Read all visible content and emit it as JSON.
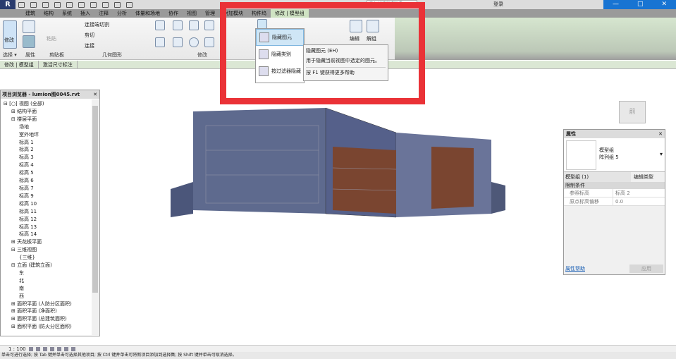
{
  "qat": {
    "logo": "R",
    "search_placeholder": "键入关键字或短语",
    "login": "登录"
  },
  "window": {
    "minimize": "—",
    "maximize": "□",
    "close": "✕"
  },
  "tabs": [
    "建筑",
    "结构",
    "系统",
    "插入",
    "注释",
    "分析",
    "体量和场地",
    "协作",
    "视图",
    "管理",
    "附加模块",
    "构件坞",
    "修改 | 模型组"
  ],
  "active_tab": "修改 | 模型组",
  "ribbon": {
    "select": {
      "modify": "修改",
      "label": "选择 ▾"
    },
    "properties_label": "属性",
    "clipboard": {
      "paste": "粘贴",
      "label": "剪贴板"
    },
    "geometry": {
      "cope": "连接端切割",
      "cut": "剪切",
      "join": "连接",
      "label": "几何图形"
    },
    "modify_label": "修改",
    "group": {
      "edit": "编辑",
      "ungroup": "解组"
    }
  },
  "hide_menu": {
    "items": [
      "隐藏图元",
      "隐藏类别",
      "按过滤器隐藏"
    ],
    "highlighted": "隐藏图元"
  },
  "tooltip": {
    "title": "隐藏图元 (EH)",
    "desc": "用于隐藏当前视图中选定的图元。",
    "help": "按 F1 键获得更多帮助"
  },
  "context_bar": [
    "修改 | 模型组",
    "激活尺寸标注"
  ],
  "browser": {
    "title": "项目浏览器 - lumion图0045.rvt",
    "tree": [
      {
        "t": "⊟ [○] 视图 (全部)",
        "l": 0
      },
      {
        "t": "⊞ 结构平面",
        "l": 1
      },
      {
        "t": "⊟ 楼层平面",
        "l": 1
      },
      {
        "t": "场地",
        "l": 2
      },
      {
        "t": "室外地坪",
        "l": 2
      },
      {
        "t": "标高 1",
        "l": 2
      },
      {
        "t": "标高 2",
        "l": 2
      },
      {
        "t": "标高 3",
        "l": 2
      },
      {
        "t": "标高 4",
        "l": 2
      },
      {
        "t": "标高 5",
        "l": 2
      },
      {
        "t": "标高 6",
        "l": 2
      },
      {
        "t": "标高 7",
        "l": 2
      },
      {
        "t": "标高 9",
        "l": 2
      },
      {
        "t": "标高 10",
        "l": 2
      },
      {
        "t": "标高 11",
        "l": 2
      },
      {
        "t": "标高 12",
        "l": 2
      },
      {
        "t": "标高 13",
        "l": 2
      },
      {
        "t": "标高 14",
        "l": 2
      },
      {
        "t": "⊞ 天花板平面",
        "l": 1
      },
      {
        "t": "⊟ 三维视图",
        "l": 1
      },
      {
        "t": "{三维}",
        "l": 2
      },
      {
        "t": "⊟ 立面 (建筑立面)",
        "l": 1
      },
      {
        "t": "东",
        "l": 2
      },
      {
        "t": "北",
        "l": 2
      },
      {
        "t": "南",
        "l": 2
      },
      {
        "t": "西",
        "l": 2
      },
      {
        "t": "⊞ 面积平面 (人防分区面积)",
        "l": 1
      },
      {
        "t": "⊞ 面积平面 (净面积)",
        "l": 1
      },
      {
        "t": "⊞ 面积平面 (总建筑面积)",
        "l": 1
      },
      {
        "t": "⊞ 面积平面 (防火分区面积)",
        "l": 1
      }
    ]
  },
  "viewcube": "前",
  "properties": {
    "title": "属性",
    "type_line1": "模型组",
    "type_line2": "阵列组 5",
    "selector": "模型组 (1)",
    "edit_type": "编辑类型",
    "section": "限制条件",
    "rows": [
      {
        "k": "参照标高",
        "v": "标高 2"
      },
      {
        "k": "原点标高偏移",
        "v": "0.0"
      }
    ],
    "help": "属性帮助",
    "apply": "应用"
  },
  "viewbar": {
    "scale": "1 : 100"
  },
  "status": "单击可进行选择; 按 Tab 键并单击可选择其他项目; 按 Ctrl 键并单击可将新项目添加到选择集; 按 Shift 键并单击可取消选择。",
  "colors": {
    "highlight_box": "#ea3237",
    "context_tab": "#cfe3c3",
    "title_blue": "#1874d2"
  }
}
